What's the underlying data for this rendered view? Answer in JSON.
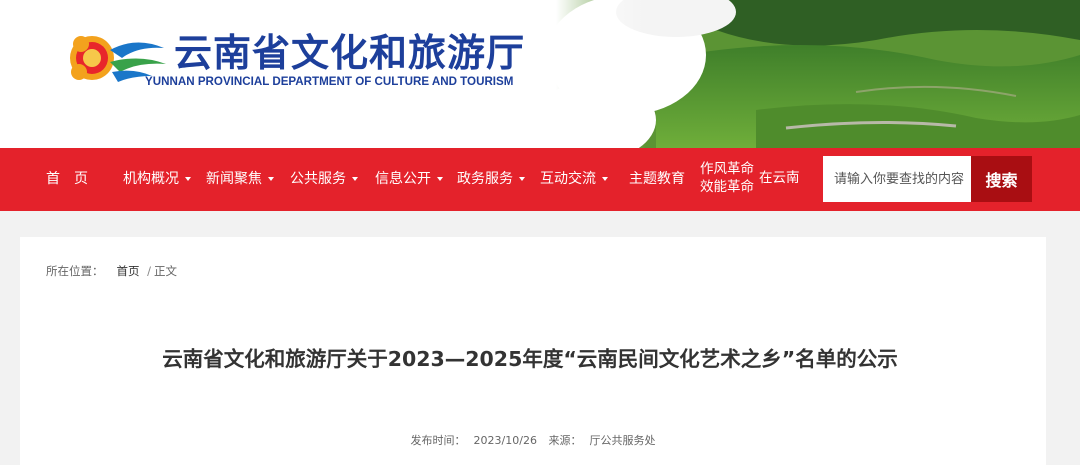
{
  "header": {
    "title": "云南省文化和旅游厅",
    "subtitle": "YUNNAN PROVINCIAL DEPARTMENT OF CULTURE AND TOURISM"
  },
  "nav": {
    "items": [
      {
        "label": "首　页",
        "dropdown": false
      },
      {
        "label": "机构概况",
        "dropdown": true
      },
      {
        "label": "新闻聚焦",
        "dropdown": true
      },
      {
        "label": "公共服务",
        "dropdown": true
      },
      {
        "label": "信息公开",
        "dropdown": true
      },
      {
        "label": "政务服务",
        "dropdown": true
      },
      {
        "label": "互动交流",
        "dropdown": true
      },
      {
        "label": "主题教育",
        "dropdown": false
      }
    ],
    "special": {
      "line1": "作风革命",
      "line2": "效能革命",
      "suffix": "在云南"
    },
    "search": {
      "placeholder": "请输入你要查找的内容",
      "button_label": "搜索"
    }
  },
  "breadcrumb": {
    "label": "所在位置：",
    "home": "首页",
    "separator": "/",
    "current": "正文"
  },
  "article": {
    "title": "云南省文化和旅游厅关于2023—2025年度“云南民间文化艺术之乡”名单的公示",
    "publish_label": "发布时间：",
    "publish_date": "2023/10/26",
    "source_label": "来源：",
    "source": "厅公共服务处"
  },
  "colors": {
    "nav_red": "#e4222b",
    "search_button": "#a90e12",
    "title_blue": "#1d3f9b",
    "page_background": "#f2f2f2"
  }
}
